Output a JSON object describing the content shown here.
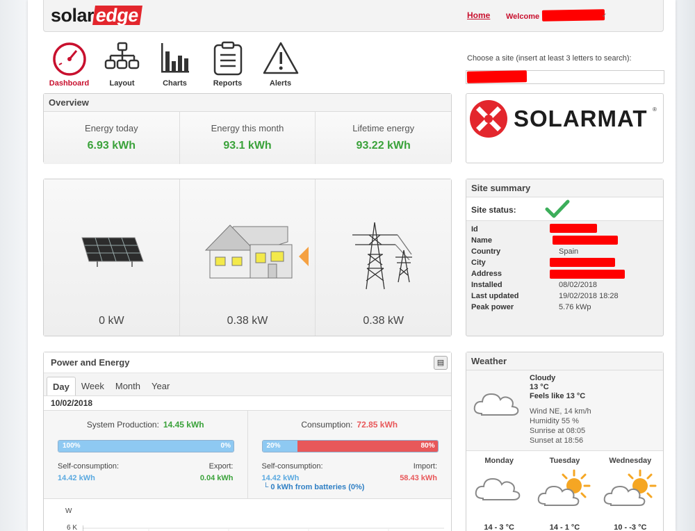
{
  "header": {
    "logo_solar": "solar",
    "logo_edge": "edge",
    "home_label": "Home",
    "welcome_label": "Welcome"
  },
  "nav": [
    {
      "label": "Dashboard",
      "icon": "dashboard-gauge-icon",
      "active": true
    },
    {
      "label": "Layout",
      "icon": "layout-tree-icon",
      "active": false
    },
    {
      "label": "Charts",
      "icon": "bar-chart-icon",
      "active": false
    },
    {
      "label": "Reports",
      "icon": "report-clipboard-icon",
      "active": false
    },
    {
      "label": "Alerts",
      "icon": "warning-triangle-icon",
      "active": false
    }
  ],
  "site_search": {
    "label": "Choose a site (insert at least 3 letters to search):",
    "value": ""
  },
  "overview": {
    "title": "Overview",
    "cells": [
      {
        "label": "Energy today",
        "value": "6.93 kWh"
      },
      {
        "label": "Energy this month",
        "value": "93.1 kWh"
      },
      {
        "label": "Lifetime energy",
        "value": "93.22 kWh"
      }
    ]
  },
  "brand": {
    "name": "SOLARMAT",
    "reg": "®"
  },
  "flow": {
    "panels": [
      {
        "icon": "solar-panel-icon",
        "value": "0 kW"
      },
      {
        "icon": "house-icon",
        "value": "0.38 kW"
      },
      {
        "icon": "power-grid-tower-icon",
        "value": "0.38 kW"
      }
    ],
    "arrow_color": "#f5a142"
  },
  "site_summary": {
    "title": "Site summary",
    "status_label": "Site status:",
    "status_icon": "green-check-icon",
    "rows": [
      {
        "key": "Id",
        "value": ""
      },
      {
        "key": "Name",
        "value": ""
      },
      {
        "key": "Country",
        "value": "Spain"
      },
      {
        "key": "City",
        "value": ""
      },
      {
        "key": "Address",
        "value": ""
      },
      {
        "key": "Installed",
        "value": "08/02/2018"
      },
      {
        "key": "Last updated",
        "value": "19/02/2018 18:28"
      },
      {
        "key": "Peak power",
        "value": "5.76 kWp"
      }
    ]
  },
  "power_energy": {
    "title": "Power and Energy",
    "tabs": [
      "Day",
      "Week",
      "Month",
      "Year"
    ],
    "active_tab": "Day",
    "date": "10/02/2018",
    "production": {
      "label": "System Production:",
      "value": "14.45 kWh",
      "self_pct_label": "100%",
      "export_pct_label": "0%",
      "self_pct": 100,
      "self_label": "Self-consumption:",
      "self_value": "14.42 kWh",
      "export_label": "Export:",
      "export_value": "0.04 kWh"
    },
    "consumption": {
      "label": "Consumption:",
      "value": "72.85 kWh",
      "self_pct_label": "20%",
      "import_pct_label": "80%",
      "self_pct": 20,
      "self_label": "Self-consumption:",
      "self_value": "14.42 kWh",
      "import_label": "Import:",
      "import_value": "58.43 kWh",
      "battery_note": "└ 0 kWh from batteries (0%)"
    },
    "chart": {
      "unit": "W",
      "first_tick": "6 K"
    }
  },
  "weather": {
    "title": "Weather",
    "now": {
      "condition": "Cloudy",
      "temp": "13 °C",
      "feels": "Feels like 13 °C",
      "wind": "Wind NE, 14 km/h",
      "humidity": "Humidity 55 %",
      "sunrise": "Sunrise at 08:05",
      "sunset": "Sunset at 18:56"
    },
    "days": [
      {
        "name": "Monday",
        "icon": "cloud-icon",
        "temp": "14 - 3 °C"
      },
      {
        "name": "Tuesday",
        "icon": "sun-cloud-icon",
        "temp": "14 - 1 °C"
      },
      {
        "name": "Wednesday",
        "icon": "sun-cloud-icon",
        "temp": "10 - -3 °C"
      }
    ]
  },
  "colors": {
    "accent_red": "#c8102e",
    "green": "#3aa23a",
    "blue_bar": "#8ec9f2",
    "red_bar": "#e8585a"
  }
}
